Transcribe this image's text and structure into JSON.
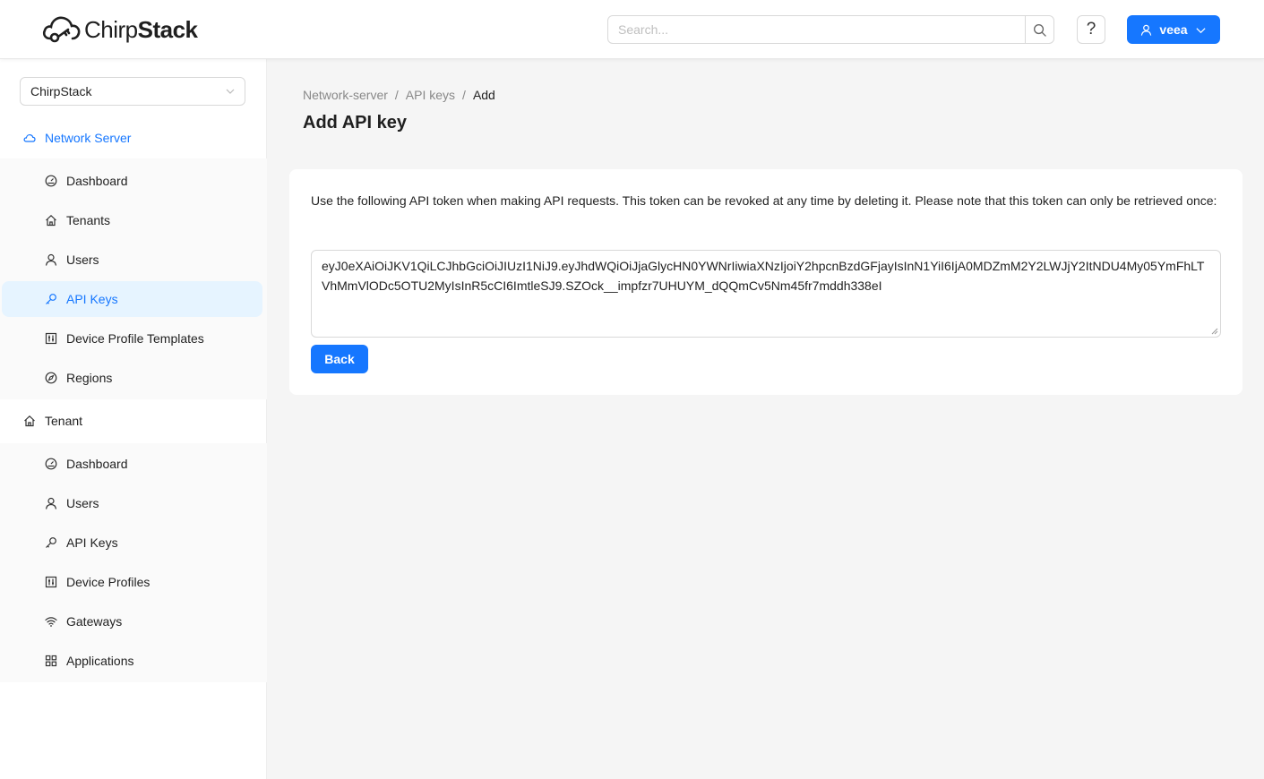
{
  "header": {
    "logo_text_light": "Chirp",
    "logo_text_bold": "Stack",
    "search_placeholder": "Search...",
    "help_label": "?",
    "user_label": "veea"
  },
  "sidebar": {
    "tenant_select_value": "ChirpStack",
    "groups": [
      {
        "title": "Network Server",
        "active": true,
        "items": [
          {
            "label": "Dashboard",
            "icon": "dashboard-icon"
          },
          {
            "label": "Tenants",
            "icon": "home-icon"
          },
          {
            "label": "Users",
            "icon": "user-icon"
          },
          {
            "label": "API Keys",
            "icon": "key-icon",
            "selected": true
          },
          {
            "label": "Device Profile Templates",
            "icon": "control-icon"
          },
          {
            "label": "Regions",
            "icon": "compass-icon"
          }
        ]
      },
      {
        "title": "Tenant",
        "active": false,
        "items": [
          {
            "label": "Dashboard",
            "icon": "dashboard-icon"
          },
          {
            "label": "Users",
            "icon": "user-icon"
          },
          {
            "label": "API Keys",
            "icon": "key-icon"
          },
          {
            "label": "Device Profiles",
            "icon": "control-icon"
          },
          {
            "label": "Gateways",
            "icon": "wifi-icon"
          },
          {
            "label": "Applications",
            "icon": "appstore-icon"
          }
        ]
      }
    ]
  },
  "main": {
    "breadcrumb": [
      "Network-server",
      "API keys",
      "Add"
    ],
    "title": "Add API key",
    "description": "Use the following API token when making API requests. This token can be revoked at any time by deleting it. Please note that this token can only be retrieved once:",
    "token": "eyJ0eXAiOiJKV1QiLCJhbGciOiJIUzI1NiJ9.eyJhdWQiOiJjaGlycHN0YWNrIiwiaXNzIjoiY2hpcnBzdGFjayIsInN1YiI6IjA0MDZmM2Y2LWJjY2ItNDU4My05YmFhLTVhMmVlODc5OTU2MyIsInR5cCI6ImtleSJ9.SZOck__impfzr7UHUYM_dQQmCv5Nm45fr7mddh338eI",
    "back_label": "Back"
  },
  "colors": {
    "primary": "#1677ff",
    "selected_bg": "#e6f4ff"
  }
}
